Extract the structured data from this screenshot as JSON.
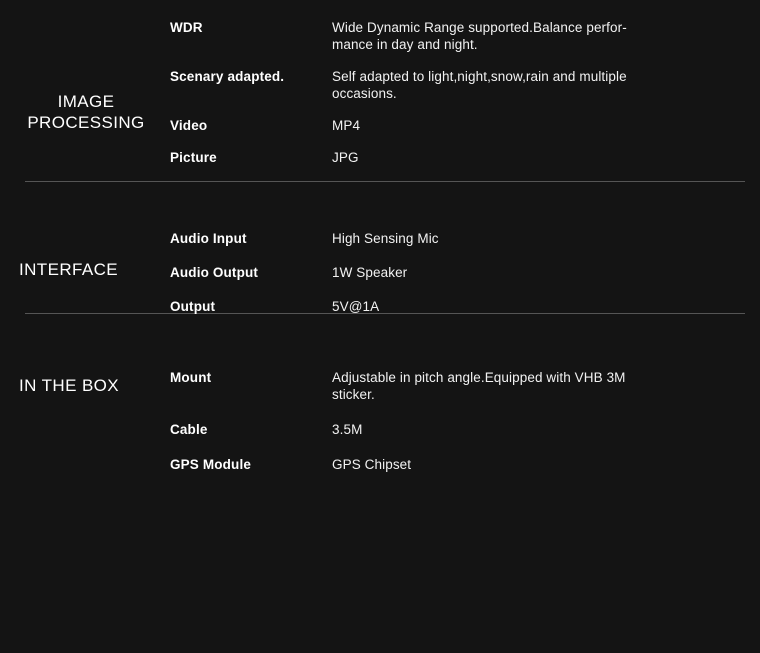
{
  "page": {
    "background_color": "#141414",
    "text_color": "#ffffff",
    "divider_color": "#555555"
  },
  "sections": [
    {
      "id": "image-processing",
      "heading": "IMAGE\nPROCESSING",
      "rows": [
        {
          "label": "WDR",
          "value": "Wide Dynamic Range supported.Balance perfor-\nmance in day and night."
        },
        {
          "label": "Scenary adapted.",
          "value": "Self adapted to light,night,snow,rain and multiple\noccasions."
        },
        {
          "label": "Video",
          "value": "MP4"
        },
        {
          "label": "Picture",
          "value": "JPG"
        }
      ]
    },
    {
      "id": "interface",
      "heading": "INTERFACE",
      "rows": [
        {
          "label": "Audio Input",
          "value": "High Sensing Mic"
        },
        {
          "label": "Audio Output",
          "value": "1W Speaker"
        },
        {
          "label": "Output",
          "value": "5V@1A"
        }
      ]
    },
    {
      "id": "in-the-box",
      "heading": "IN THE BOX",
      "rows": [
        {
          "label": "Mount",
          "value": "Adjustable in pitch angle.Equipped with VHB 3M\nsticker."
        },
        {
          "label": "Cable",
          "value": "3.5M"
        },
        {
          "label": "GPS Module",
          "value": "GPS Chipset"
        }
      ]
    }
  ]
}
